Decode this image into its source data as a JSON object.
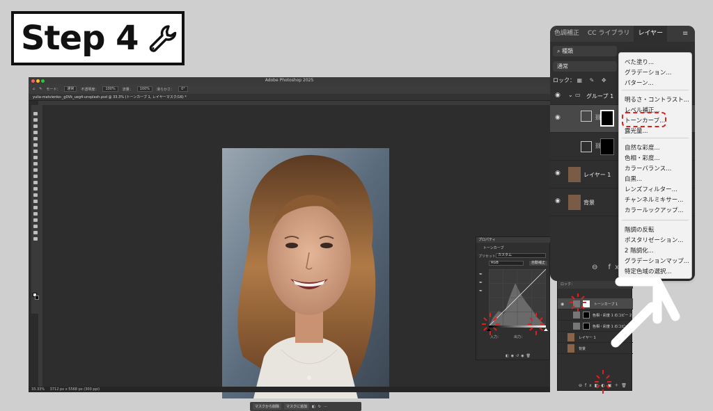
{
  "step_badge": {
    "label": "Step 4",
    "icon": "wrench-icon"
  },
  "ps": {
    "title": "Adobe Photoshop 2025",
    "doc_tab": "yulia-matvienko-_g0Vk_ueg4-unsplash.psd @ 33.3% (トーンカーブ 1, レイヤーマスク/16) *",
    "options": {
      "mode_label": "モード：",
      "mode_value": "通常",
      "opacity_label": "不透明度：",
      "opacity_value": "100%",
      "flow_label": "流量：",
      "flow_value": "100%",
      "smooth_label": "滑らかさ：",
      "angle_value": "0°"
    },
    "status": {
      "zoom": "33.33%",
      "size": "3712 px x 5568 px (300 ppi)"
    },
    "context_bar": {
      "subtract": "マスクから削除",
      "add": "マスクに追加"
    }
  },
  "properties_panel": {
    "header": "プロパティ",
    "type": "トーンカーブ",
    "preset_label": "プリセット：",
    "preset_value": "カスタム",
    "channel_value": "RGB",
    "auto_label": "自動補正",
    "input_label": "入力：",
    "output_label": "出力："
  },
  "layers_small": {
    "rows": [
      {
        "name": "トーンカーブ 1"
      },
      {
        "name": "色相・彩度 1 のコピー 2"
      },
      {
        "name": "色相・彩度 1 のコピー"
      },
      {
        "name": "レイヤー 1"
      },
      {
        "name": "背景"
      }
    ]
  },
  "zoom_panel": {
    "tabs": [
      "色調補正",
      "CC ライブラリ",
      "レイヤー"
    ],
    "search_label": "種類",
    "blend_value": "通常",
    "lock_label": "ロック：",
    "layers": [
      {
        "name": "グループ 1"
      },
      {
        "name": ""
      },
      {
        "name": ""
      },
      {
        "name": "レイヤー 1"
      },
      {
        "name": "背景"
      }
    ]
  },
  "menu": {
    "group1": [
      "べた塗り...",
      "グラデーション...",
      "パターン..."
    ],
    "group2": [
      "明るさ・コントラスト...",
      "レベル補正...",
      "トーンカーブ...",
      "露光量..."
    ],
    "group3": [
      "自然な彩度...",
      "色相・彩度...",
      "カラーバランス...",
      "白黒...",
      "レンズフィルター...",
      "チャンネルミキサー...",
      "カラールックアップ..."
    ],
    "group4": [
      "階調の反転",
      "ポスタリゼーション...",
      "2 階調化...",
      "グラデーションマップ...",
      "特定色域の選択..."
    ]
  },
  "colors": {
    "highlight": "#e0201c",
    "arrow": "#ffffff"
  }
}
